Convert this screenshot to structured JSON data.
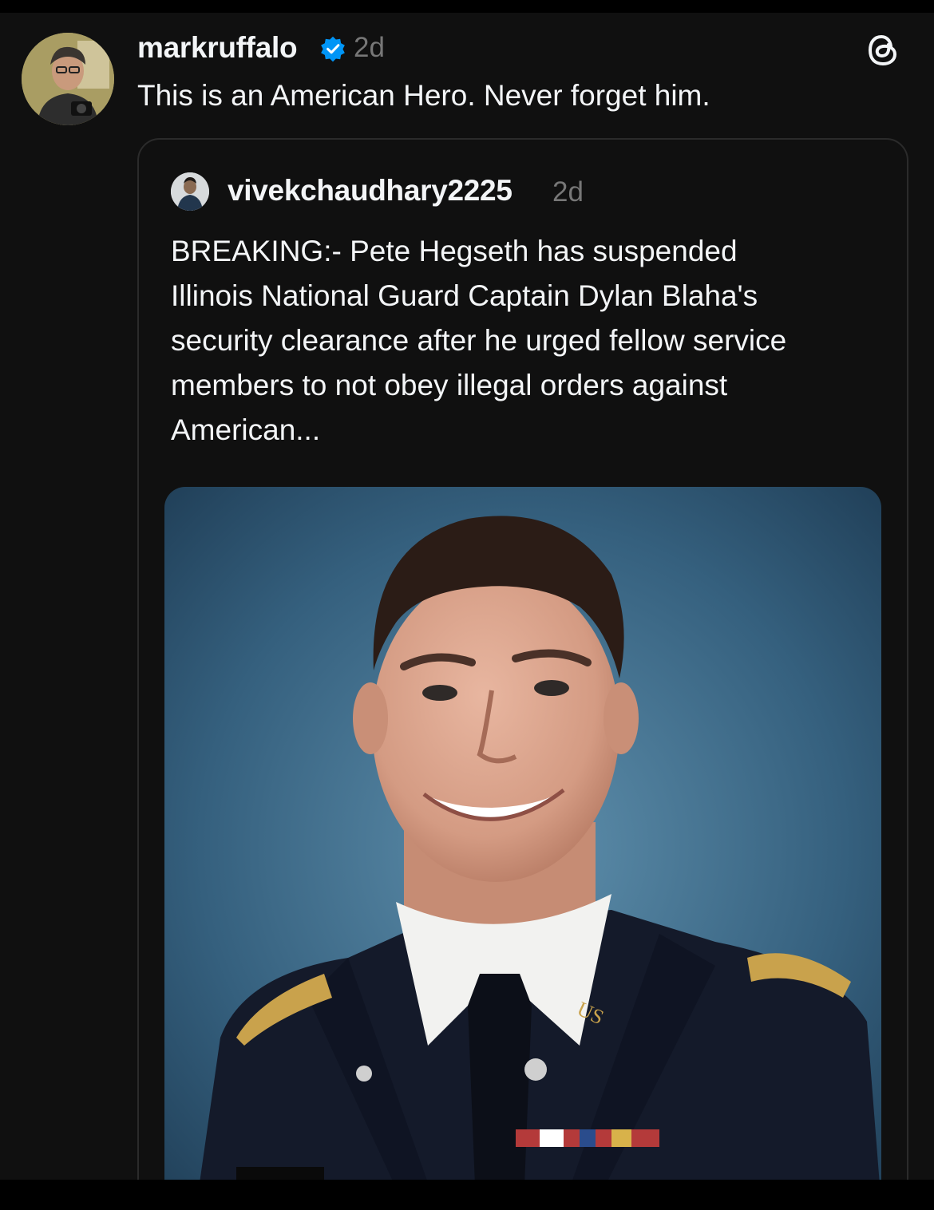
{
  "post": {
    "author": "markruffalo",
    "verified_icon": "verified-badge-icon",
    "time": "2d",
    "text": "This is an American Hero. Never forget him.",
    "app_icon": "threads-logo-icon"
  },
  "quoted_post": {
    "author": "vivekchaudhary2225",
    "time": "2d",
    "text": "BREAKING:- Pete Hegseth has suspended\nIllinois National Guard Captain Dylan Blaha's\nsecurity clearance after he urged fellow service\nmembers to not obey illegal orders against\nAmerican...",
    "image": "portrait-photo-soldier-in-uniform"
  },
  "colors": {
    "background": "#101010",
    "text": "#f3f5f7",
    "muted": "#777777",
    "verified": "#0095f6",
    "border": "#2b2b2b"
  }
}
